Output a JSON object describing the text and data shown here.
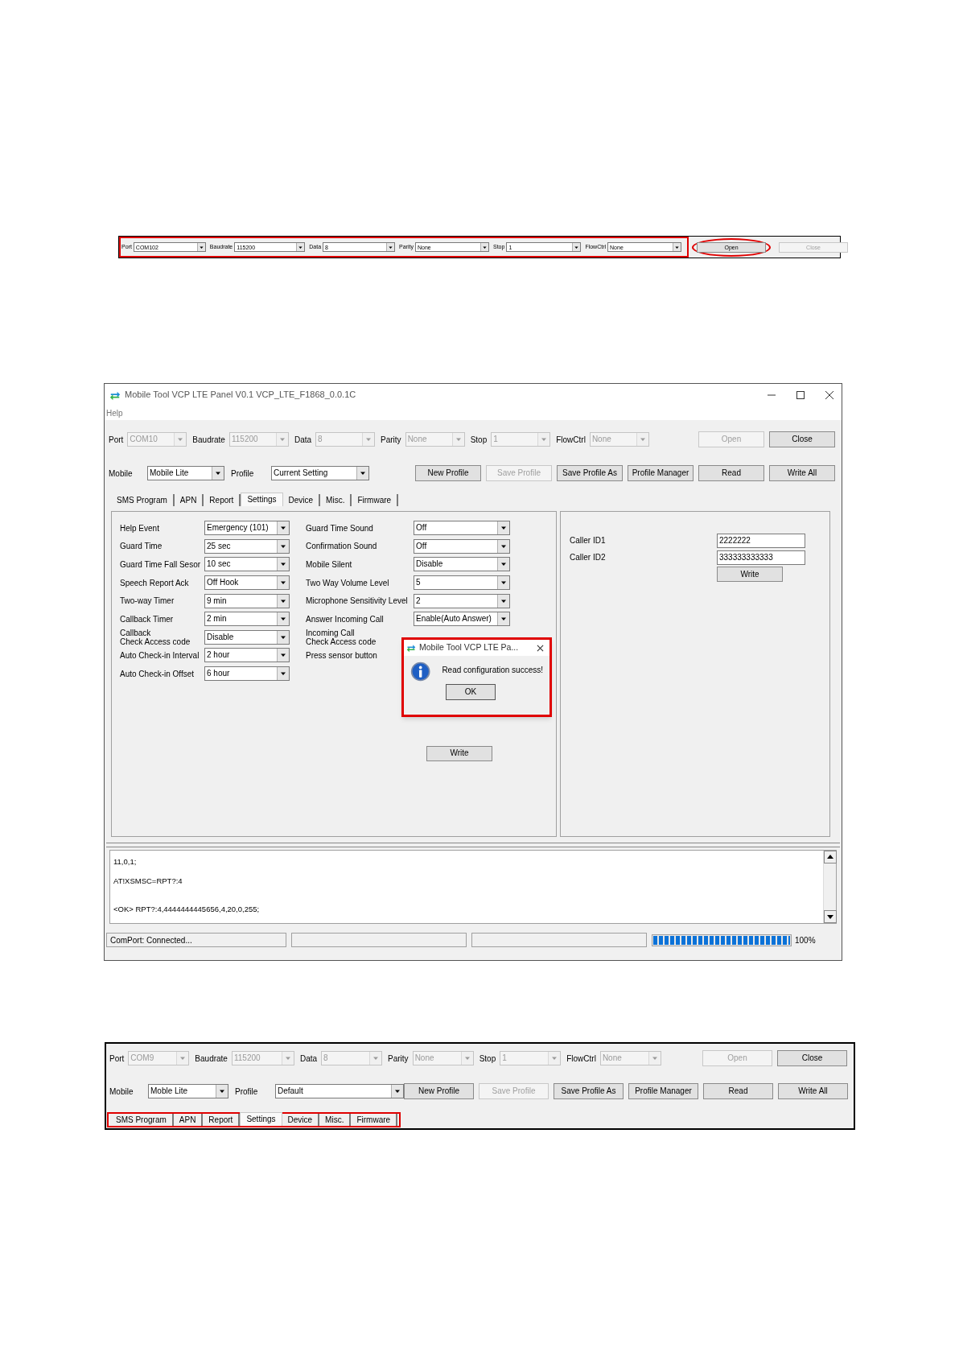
{
  "figure_1": {
    "serial_fields_highlighted": true,
    "serial_fields": [
      {
        "label": "Port",
        "value": "COM102",
        "disabled": false
      },
      {
        "label": "Baudrate",
        "value": "115200",
        "disabled": false
      },
      {
        "label": "Data",
        "value": "8",
        "disabled": false
      },
      {
        "label": "Parity",
        "value": "None",
        "disabled": false
      },
      {
        "label": "Stop",
        "value": "1",
        "disabled": false
      },
      {
        "label": "FlowCtrl",
        "value": "None",
        "disabled": false
      }
    ],
    "buttons": [
      {
        "label": "Open",
        "disabled": false,
        "circled": true
      },
      {
        "label": "Close",
        "disabled": true,
        "circled": false
      }
    ]
  },
  "figure_2": {
    "window": {
      "title": "Mobile Tool VCP LTE Panel V0.1 VCP_LTE_F1868_0.0.1C"
    },
    "menu": [
      "Help"
    ],
    "serial_fields": [
      {
        "label": "Port",
        "value": "COM10",
        "disabled": true
      },
      {
        "label": "Baudrate",
        "value": "115200",
        "disabled": true
      },
      {
        "label": "Data",
        "value": "8",
        "disabled": true
      },
      {
        "label": "Parity",
        "value": "None",
        "disabled": true
      },
      {
        "label": "Stop",
        "value": "1",
        "disabled": true
      },
      {
        "label": "FlowCtrl",
        "value": "None",
        "disabled": true
      }
    ],
    "serial_buttons": [
      {
        "label": "Open",
        "disabled": true
      },
      {
        "label": "Close",
        "disabled": false
      }
    ],
    "mobile": {
      "label": "Mobile",
      "value": "Mobile Lite"
    },
    "profile": {
      "label": "Profile",
      "value": "Current Setting"
    },
    "profile_buttons": [
      {
        "label": "New Profile",
        "disabled": false
      },
      {
        "label": "Save Profile",
        "disabled": true
      },
      {
        "label": "Save Profile As",
        "disabled": false
      },
      {
        "label": "Profile Manager",
        "disabled": false
      },
      {
        "label": "Read",
        "disabled": false
      },
      {
        "label": "Write All",
        "disabled": false
      }
    ],
    "tabs_highlighted": false,
    "tabs": [
      {
        "label": "SMS Program",
        "selected": false
      },
      {
        "label": "APN",
        "selected": false
      },
      {
        "label": "Report",
        "selected": false
      },
      {
        "label": "Settings",
        "selected": true
      },
      {
        "label": "Device",
        "selected": false
      },
      {
        "label": "Misc.",
        "selected": false
      },
      {
        "label": "Firmware",
        "selected": false
      }
    ],
    "settings_left": [
      {
        "label": "Help Event",
        "value": "Emergency (101)"
      },
      {
        "label": "Guard Time",
        "value": "25 sec"
      },
      {
        "label": "Guard Time Fall Sesor",
        "value": "10 sec"
      },
      {
        "label": "Speech Report Ack",
        "value": "Off Hook"
      },
      {
        "label": "Two-way Timer",
        "value": "9 min"
      },
      {
        "label": "Callback Timer",
        "value": "2 min"
      },
      {
        "label": "Callback\nCheck Access code",
        "value": "Disable"
      },
      {
        "label": "Auto Check-in Interval",
        "value": "2 hour"
      },
      {
        "label": "Auto Check-in Offset",
        "value": "6 hour"
      }
    ],
    "settings_middle": [
      {
        "label": "Guard Time Sound",
        "value": "Off"
      },
      {
        "label": "Confirmation Sound",
        "value": "Off"
      },
      {
        "label": "Mobile Silent",
        "value": "Disable"
      },
      {
        "label": "Two Way Volume Level",
        "value": "5"
      },
      {
        "label": "Microphone Sensitivity Level",
        "value": "2"
      },
      {
        "label": "Answer Incoming Call",
        "value": "Enable(Auto Answer)"
      },
      {
        "label": "Incoming Call\nCheck Access code"
      },
      {
        "label": "Press sensor button"
      }
    ],
    "settings_write": "Write",
    "caller_ids": [
      {
        "label": "Caller ID1",
        "value": "2222222"
      },
      {
        "label": "Caller ID2",
        "value": "333333333333"
      }
    ],
    "caller_write": "Write",
    "dialog": {
      "title": "Mobile Tool VCP LTE Pa...",
      "message": "Read configuration success!",
      "button": "OK",
      "highlighted": true
    },
    "log_lines": [
      {
        "kind": "plain",
        "text": "11,0,1;"
      },
      {
        "kind": "spaced",
        "text": "AT!XSMSC=RPT?:4"
      },
      {
        "kind": "widespaced",
        "text": "<OK> RPT?:4,4444444445656,4,20,0,255;"
      }
    ],
    "status_bar": {
      "message": "ComPort: Connected...",
      "progress": {
        "level": 1,
        "reading": "100%"
      }
    }
  },
  "figure_3": {
    "serial_fields": [
      {
        "label": "Port",
        "value": "COM9",
        "disabled": true
      },
      {
        "label": "Baudrate",
        "value": "115200",
        "disabled": true
      },
      {
        "label": "Data",
        "value": "8",
        "disabled": true
      },
      {
        "label": "Parity",
        "value": "None",
        "disabled": true
      },
      {
        "label": "Stop",
        "value": "1",
        "disabled": true
      },
      {
        "label": "FlowCtrl",
        "value": "None",
        "disabled": true
      }
    ],
    "serial_buttons": [
      {
        "label": "Open",
        "disabled": true
      },
      {
        "label": "Close",
        "disabled": false
      }
    ],
    "mobile": {
      "label": "Mobile",
      "value": "Moble Lite"
    },
    "profile": {
      "label": "Profile",
      "value": "Default"
    },
    "profile_buttons": [
      {
        "label": "New Profile",
        "disabled": false
      },
      {
        "label": "Save Profile",
        "disabled": true
      },
      {
        "label": "Save Profile As",
        "disabled": false
      },
      {
        "label": "Profile Manager",
        "disabled": false
      },
      {
        "label": "Read",
        "disabled": false
      },
      {
        "label": "Write All",
        "disabled": false
      }
    ],
    "tabs_highlighted": true,
    "tabs": [
      {
        "label": "SMS Program",
        "selected": false
      },
      {
        "label": "APN",
        "selected": false
      },
      {
        "label": "Report",
        "selected": false
      },
      {
        "label": "Settings",
        "selected": true
      },
      {
        "label": "Device",
        "selected": false
      },
      {
        "label": "Misc.",
        "selected": false
      },
      {
        "label": "Firmware",
        "selected": false
      }
    ]
  }
}
